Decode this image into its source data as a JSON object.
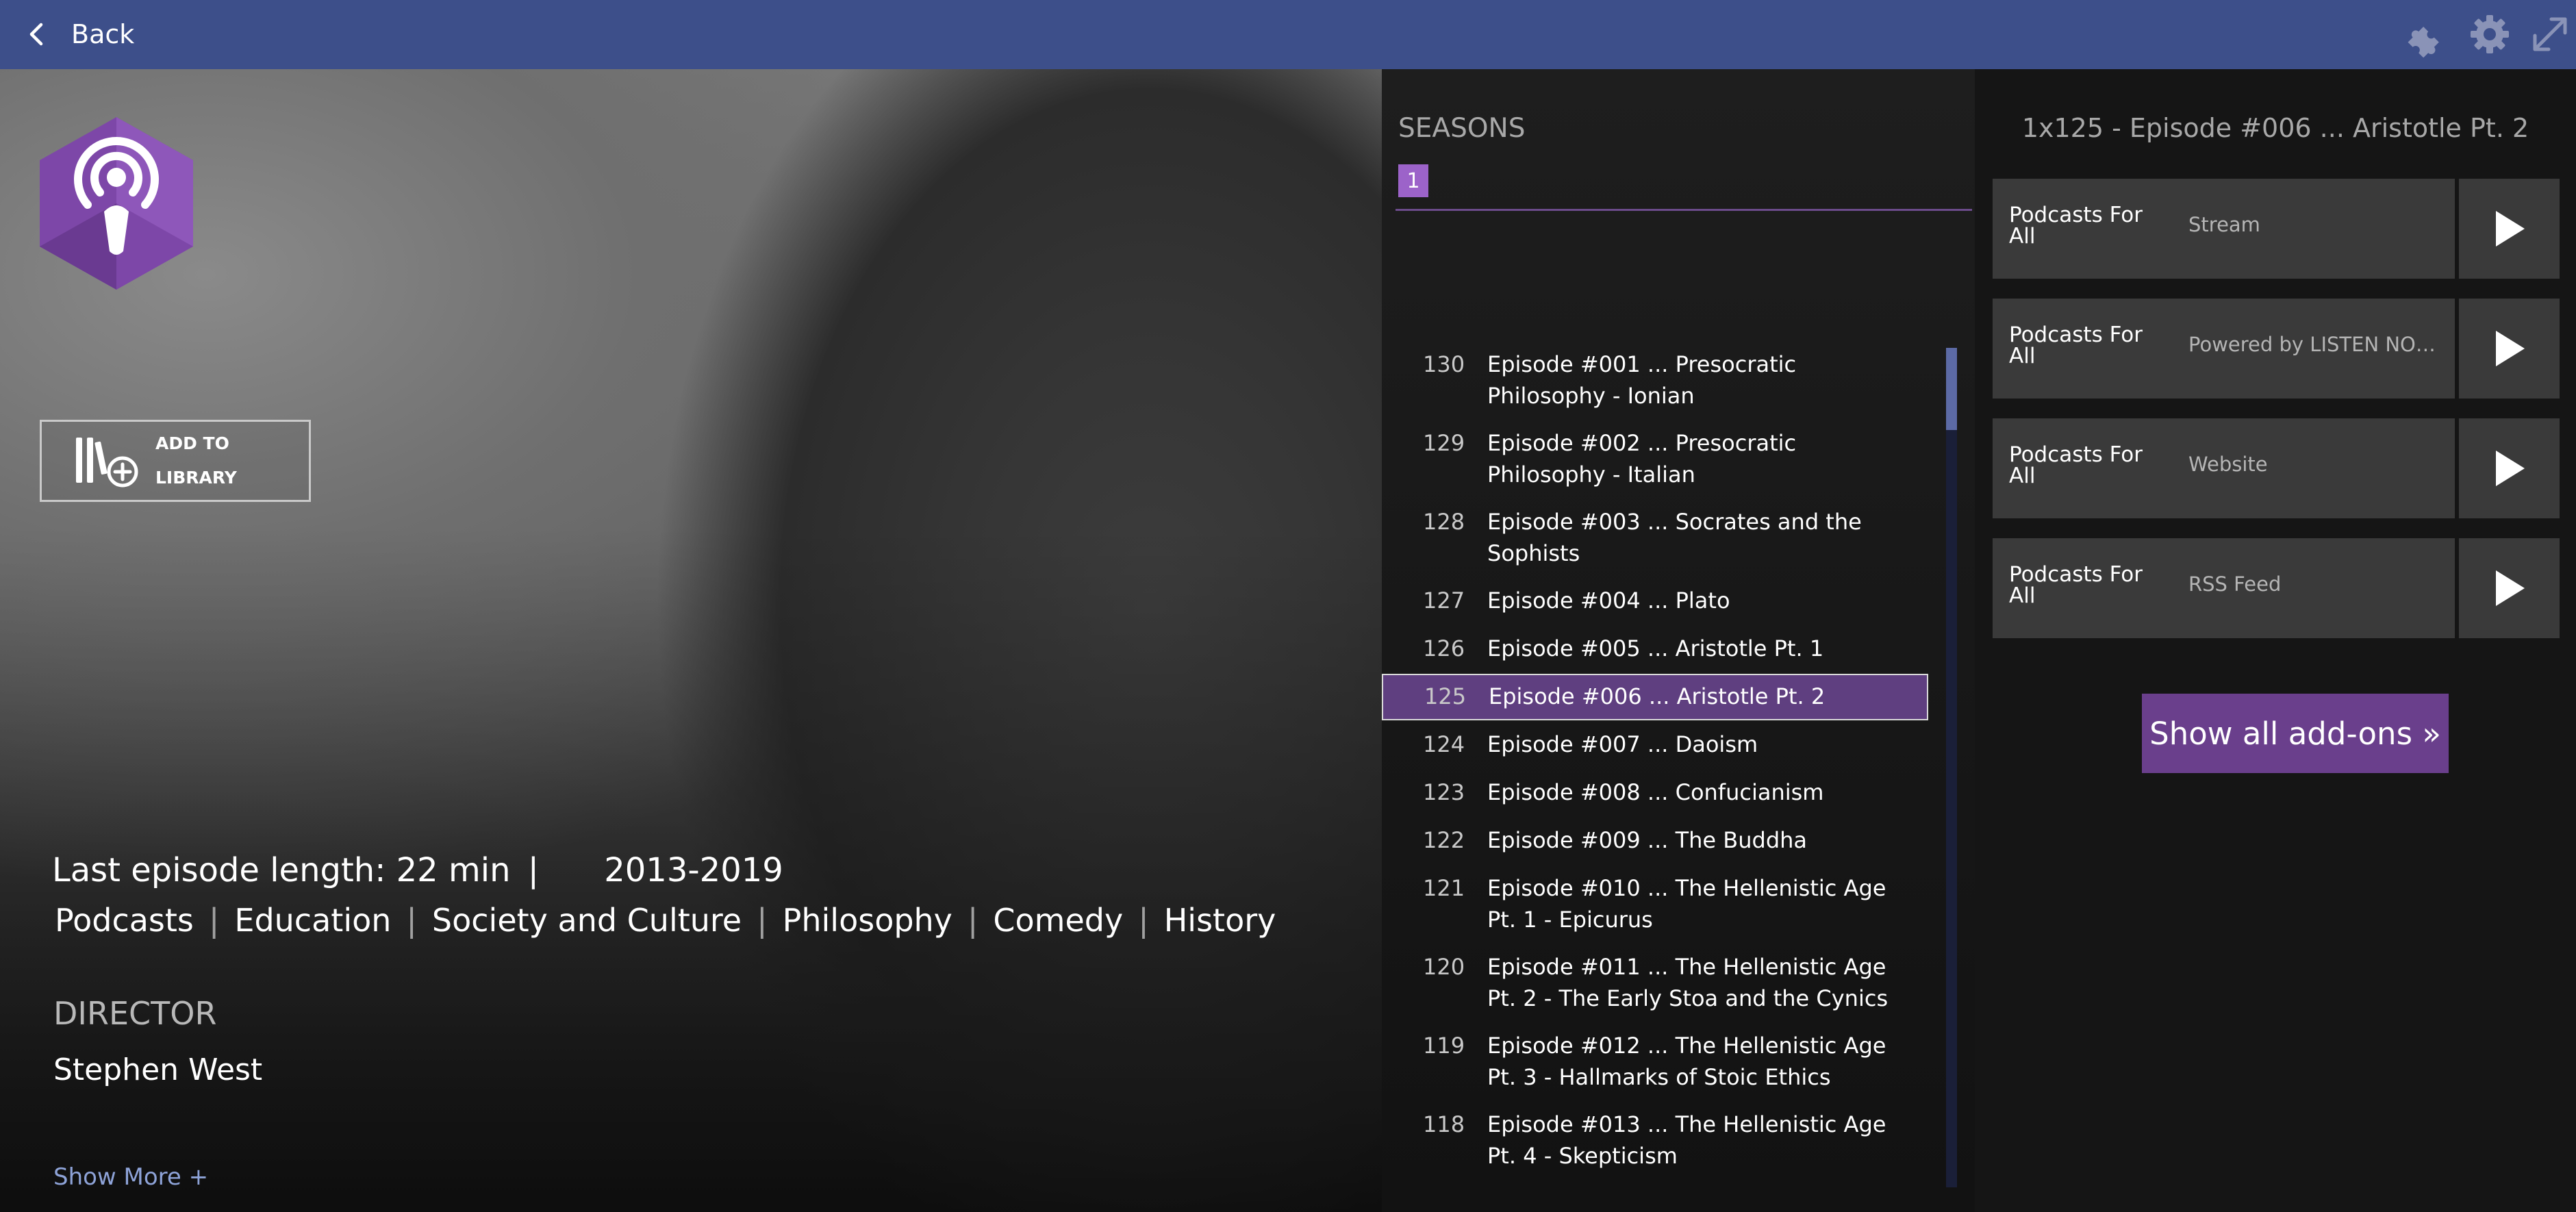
{
  "topbar": {
    "back_label": "Back",
    "icons": [
      "puzzle-icon",
      "gear-icon",
      "fullscreen-icon"
    ]
  },
  "hero": {
    "add_library_label": "ADD TO LIBRARY",
    "last_episode_length": "Last episode length: 22 min",
    "separator": "|",
    "years": "2013-2019",
    "genres": [
      "Podcasts",
      "Education",
      "Society and Culture",
      "Philosophy",
      "Comedy",
      "History"
    ],
    "director_heading": "DIRECTOR",
    "director_name": "Stephen West",
    "show_more": "Show More +"
  },
  "seasons": {
    "heading": "SEASONS",
    "selected_season": "1"
  },
  "episodes": [
    {
      "num": "130",
      "title": "Episode #001 ... Presocratic Philosophy - Ionian"
    },
    {
      "num": "129",
      "title": "Episode #002 ... Presocratic Philosophy - Italian"
    },
    {
      "num": "128",
      "title": "Episode #003 ... Socrates and the Sophists"
    },
    {
      "num": "127",
      "title": "Episode #004 ... Plato"
    },
    {
      "num": "126",
      "title": "Episode #005 ... Aristotle Pt. 1"
    },
    {
      "num": "125",
      "title": "Episode #006 ... Aristotle Pt. 2",
      "selected": true
    },
    {
      "num": "124",
      "title": "Episode #007 ... Daoism"
    },
    {
      "num": "123",
      "title": "Episode #008 ... Confucianism"
    },
    {
      "num": "122",
      "title": "Episode #009 ... The Buddha"
    },
    {
      "num": "121",
      "title": "Episode #010 ... The Hellenistic Age Pt. 1 - Epicurus"
    },
    {
      "num": "120",
      "title": "Episode #011 ... The Hellenistic Age Pt. 2 - The Early Stoa and the Cynics"
    },
    {
      "num": "119",
      "title": "Episode #012 ... The Hellenistic Age Pt. 3 - Hallmarks of Stoic Ethics"
    },
    {
      "num": "118",
      "title": "Episode #013 ... The Hellenistic Age Pt. 4 - Skepticism"
    }
  ],
  "streams": {
    "episode_title": "1x125 - Episode #006 ... Aristotle Pt. 2",
    "items": [
      {
        "addon": "Podcasts For All",
        "desc": "Stream"
      },
      {
        "addon": "Podcasts For All",
        "desc": "Powered by LISTEN NOT..."
      },
      {
        "addon": "Podcasts For All",
        "desc": "Website"
      },
      {
        "addon": "Podcasts For All",
        "desc": "RSS Feed"
      }
    ],
    "show_all_label": "Show all add-ons »"
  },
  "colors": {
    "topbar": "#3d4f8a",
    "accent_purple": "#6a3f8c",
    "selected_row": "#5f3f80",
    "season_chip": "#9c63c9",
    "link_blue": "#8ea3d8"
  }
}
